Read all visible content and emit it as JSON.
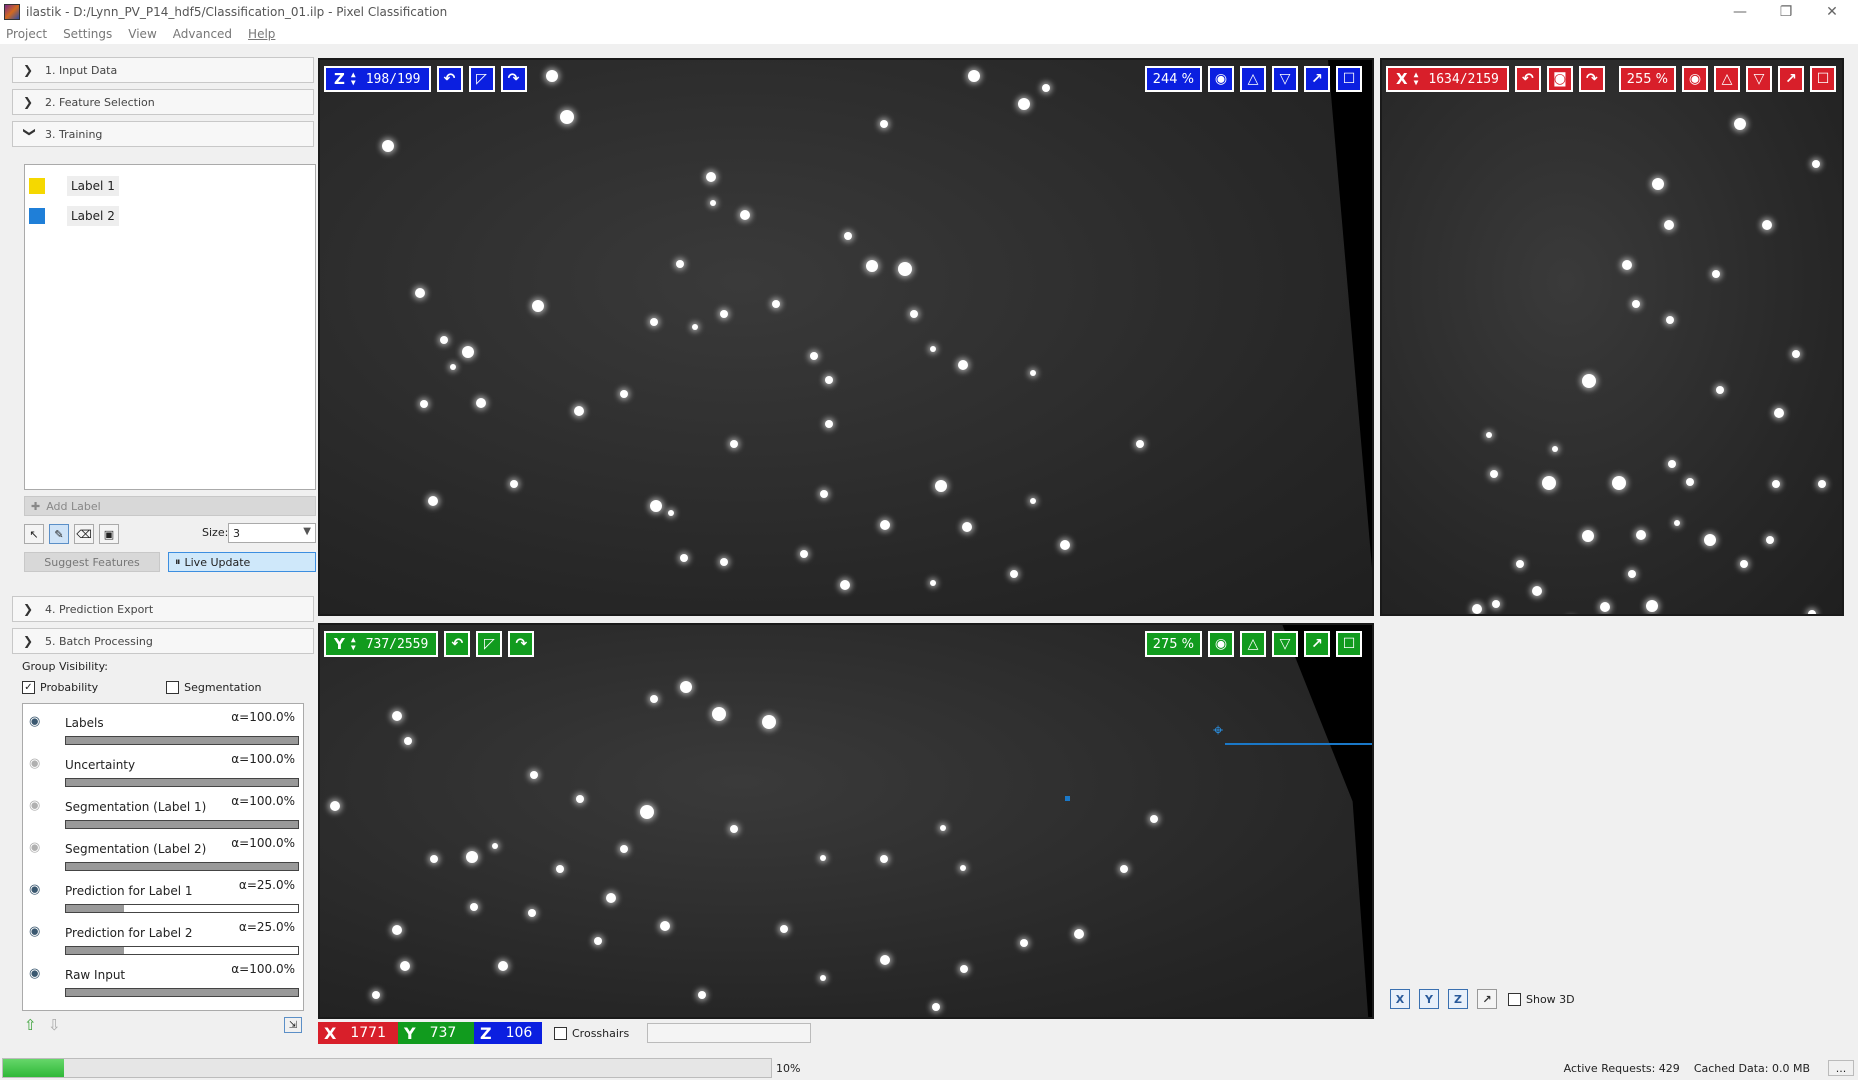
{
  "window": {
    "title": "ilastik - D:/Lynn_PV_P14_hdf5/Classification_01.ilp - Pixel Classification",
    "minimize": "—",
    "restore": "❐",
    "close": "✕"
  },
  "menu": [
    "Project",
    "Settings",
    "View",
    "Advanced",
    "Help"
  ],
  "applets": {
    "input": "1. Input Data",
    "features": "2. Feature Selection",
    "training": "3. Training",
    "export": "4. Prediction Export",
    "batch": "5. Batch Processing"
  },
  "training": {
    "labels": [
      {
        "name": "Label 1",
        "color": "#f5d800"
      },
      {
        "name": "Label 2",
        "color": "#1f7fd8"
      }
    ],
    "add_label": "Add Label",
    "size_label": "Size:",
    "size_value": "3",
    "suggest_features": "Suggest Features",
    "live_update": "Live Update"
  },
  "group_visibility": {
    "title": "Group Visibility:",
    "probability": "Probability",
    "probability_checked": true,
    "segmentation": "Segmentation",
    "segmentation_checked": false
  },
  "layers": [
    {
      "name": "Labels",
      "opacity": "α=100.0%",
      "opacity_value": 1.0,
      "visible": true
    },
    {
      "name": "Uncertainty",
      "opacity": "α=100.0%",
      "opacity_value": 1.0,
      "visible": false
    },
    {
      "name": "Segmentation (Label 1)",
      "opacity": "α=100.0%",
      "opacity_value": 1.0,
      "visible": false
    },
    {
      "name": "Segmentation (Label 2)",
      "opacity": "α=100.0%",
      "opacity_value": 1.0,
      "visible": false
    },
    {
      "name": "Prediction for Label 1",
      "opacity": "α=25.0%",
      "opacity_value": 0.25,
      "visible": true
    },
    {
      "name": "Prediction for Label 2",
      "opacity": "α=25.0%",
      "opacity_value": 0.25,
      "visible": true
    },
    {
      "name": "Raw Input",
      "opacity": "α=100.0%",
      "opacity_value": 1.0,
      "visible": true
    }
  ],
  "views": {
    "xy": {
      "axis": "Z",
      "slice": "198/199",
      "zoom": "244 %"
    },
    "yz": {
      "axis": "X",
      "slice": "1634/2159",
      "zoom": "255 %"
    },
    "xz": {
      "axis": "Y",
      "slice": "737/2559",
      "zoom": "275 %"
    }
  },
  "coords": {
    "x": "1771",
    "y": "737",
    "z": "106",
    "crosshairs": "Crosshairs"
  },
  "view3d": {
    "x": "X",
    "y": "Y",
    "z": "Z",
    "show3d": "Show 3D"
  },
  "status": {
    "progress": 0.08,
    "progress_text": "10%",
    "active_requests": "Active Requests: 429",
    "cached_data": "Cached Data: 0.0 MB",
    "more": "..."
  },
  "colors": {
    "z_axis": "#0b1fe0",
    "x_axis": "#d81f2a",
    "y_axis": "#119b1e"
  }
}
